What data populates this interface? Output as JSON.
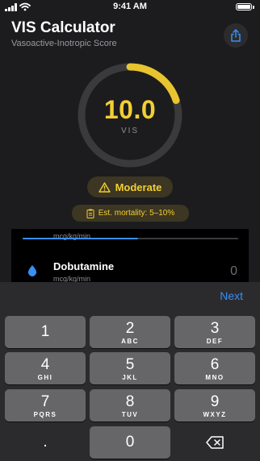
{
  "status_bar": {
    "time": "9:41 AM"
  },
  "header": {
    "title": "VIS Calculator",
    "subtitle": "Vasoactive-Inotropic Score",
    "share_icon": "share-icon"
  },
  "score": {
    "value": "10.0",
    "label": "VIS",
    "gauge_fraction": 0.2,
    "gauge_color": "#e8c42f",
    "track_color": "#3a3a3c"
  },
  "severity": {
    "label": "Moderate",
    "icon": "warning-icon",
    "color": "#f2cf33"
  },
  "mortality": {
    "label": "Est. mortality: 5–10%",
    "icon": "clipboard-icon"
  },
  "drugs": [
    {
      "name": "",
      "unit": "mcg/kg/min",
      "value": "",
      "slider_fraction": 0.54
    },
    {
      "name": "Dobutamine",
      "unit": "mcg/kg/min",
      "value": "0"
    }
  ],
  "accessory": {
    "next_label": "Next"
  },
  "keypad": {
    "keys": [
      {
        "num": "1",
        "letters": ""
      },
      {
        "num": "2",
        "letters": "ABC"
      },
      {
        "num": "3",
        "letters": "DEF"
      },
      {
        "num": "4",
        "letters": "GHI"
      },
      {
        "num": "5",
        "letters": "JKL"
      },
      {
        "num": "6",
        "letters": "MNO"
      },
      {
        "num": "7",
        "letters": "PQRS"
      },
      {
        "num": "8",
        "letters": "TUV"
      },
      {
        "num": "9",
        "letters": "WXYZ"
      },
      {
        "num": ".",
        "letters": ""
      },
      {
        "num": "0",
        "letters": ""
      },
      {
        "num": "",
        "letters": "",
        "icon": "backspace-icon"
      }
    ]
  },
  "colors": {
    "accent": "#3a8ef6",
    "warning": "#f2cf33",
    "background": "#1c1c1e"
  }
}
